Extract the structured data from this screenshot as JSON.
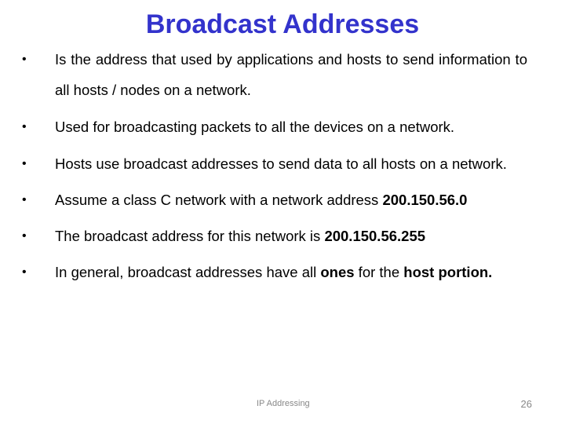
{
  "slide": {
    "title": "Broadcast Addresses",
    "title_color": "#3333cc",
    "bullet_glyph": "•",
    "bullets": [
      {
        "text": "Is the address that used by applications and hosts to send information to all hosts / nodes on a network."
      },
      {
        "text": "Used for broadcasting packets to all the devices on a network."
      },
      {
        "text": "Hosts use broadcast addresses to send data to all hosts on a network."
      },
      {
        "text_before": "Assume a class C network with a network address ",
        "bold": "200.150.56.0"
      },
      {
        "text_before": "The broadcast address for this network is ",
        "bold": "200.150.56.255"
      },
      {
        "text_before": "In general, broadcast addresses have all ",
        "bold_1": "ones",
        "text_middle": " for the ",
        "bold_2": "host portion."
      }
    ],
    "footer": {
      "label": "IP Addressing",
      "page_number": "26"
    }
  }
}
